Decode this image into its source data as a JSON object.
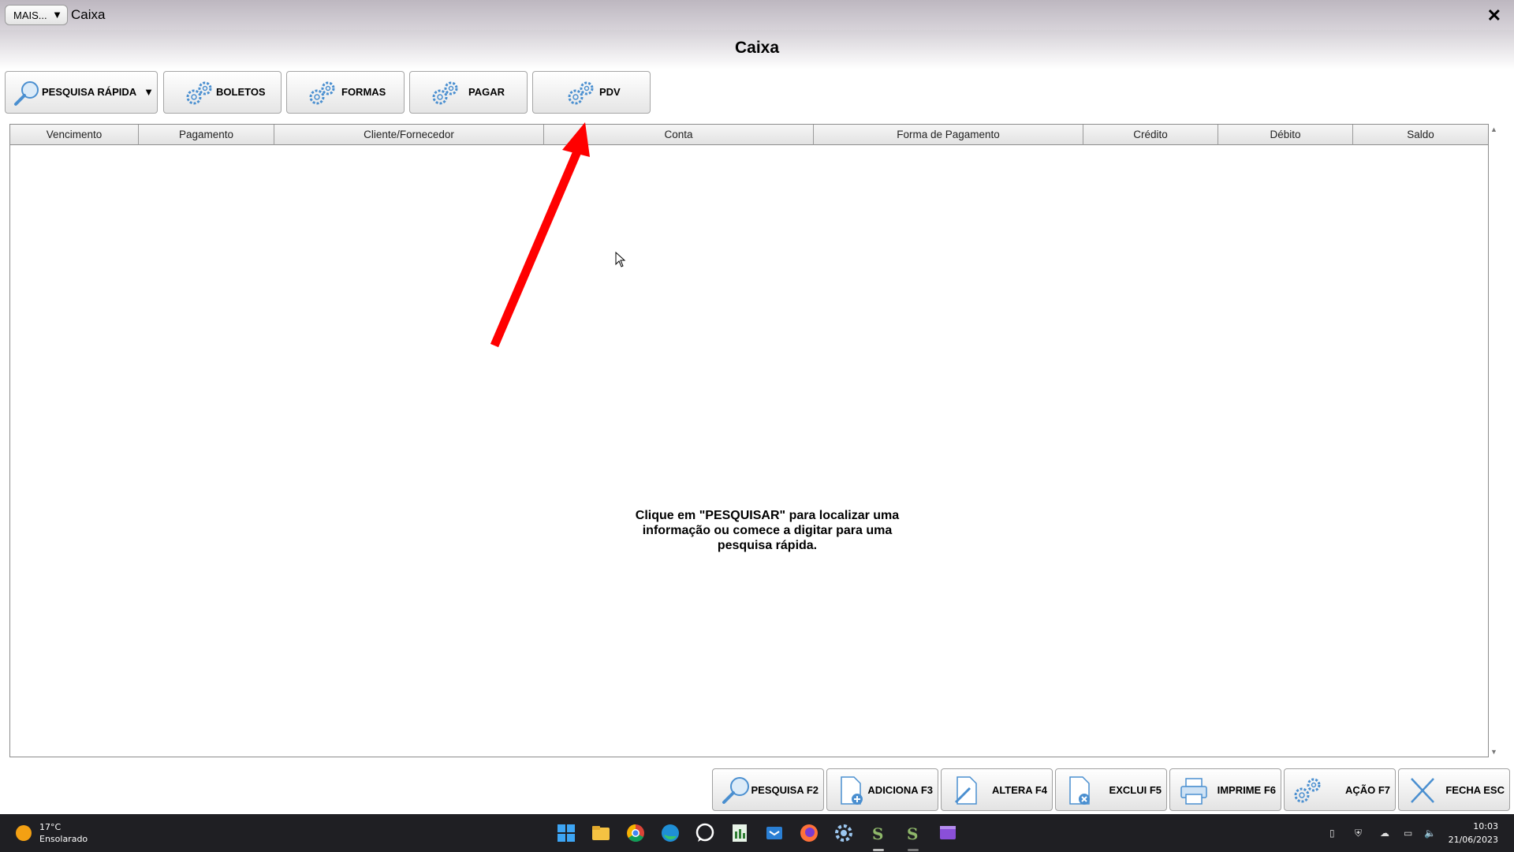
{
  "window": {
    "mais_label": "MAIS...",
    "title": "Caixa",
    "close_glyph": "✕"
  },
  "page_title": "Caixa",
  "toolbar": [
    {
      "label": "PESQUISA RÁPIDA",
      "icon": "search-icon"
    },
    {
      "label": "BOLETOS",
      "icon": "gears-icon"
    },
    {
      "label": "FORMAS",
      "icon": "gears-icon"
    },
    {
      "label": "PAGAR",
      "icon": "gears-icon"
    },
    {
      "label": "PDV",
      "icon": "gears-icon"
    }
  ],
  "table": {
    "columns": [
      "Vencimento",
      "Pagamento",
      "Cliente/Fornecedor",
      "Conta",
      "Forma de Pagamento",
      "Crédito",
      "Débito",
      "Saldo"
    ],
    "rows": [],
    "empty_hint": "Clique em \"PESQUISAR\" para localizar uma informação ou comece a digitar para uma pesquisa rápida."
  },
  "annotation": {
    "color": "#ff0000"
  },
  "actions": [
    {
      "label": "PESQUISA F2",
      "icon": "search-icon"
    },
    {
      "label": "ADICIONA F3",
      "icon": "add-document-icon"
    },
    {
      "label": "ALTERA F4",
      "icon": "edit-document-icon"
    },
    {
      "label": "EXCLUI F5",
      "icon": "delete-document-icon"
    },
    {
      "label": "IMPRIME F6",
      "icon": "printer-icon"
    },
    {
      "label": "AÇÃO F7",
      "icon": "gears-icon"
    },
    {
      "label": "FECHA ESC",
      "icon": "close-icon"
    }
  ],
  "taskbar": {
    "weather_temp": "17°C",
    "weather_desc": "Ensolarado",
    "time": "10:03",
    "date": "21/06/2023",
    "apps": [
      "windows-start-icon",
      "file-explorer-icon",
      "chrome-icon",
      "edge-icon",
      "whatsapp-icon",
      "spreadsheet-icon",
      "mail-icon",
      "firefox-icon",
      "settings-icon",
      "app-s-icon",
      "app-s2-icon",
      "video-editor-icon"
    ]
  },
  "colors": {
    "accent_blue": "#4a8fd0",
    "arrow_red": "#ff0000"
  }
}
